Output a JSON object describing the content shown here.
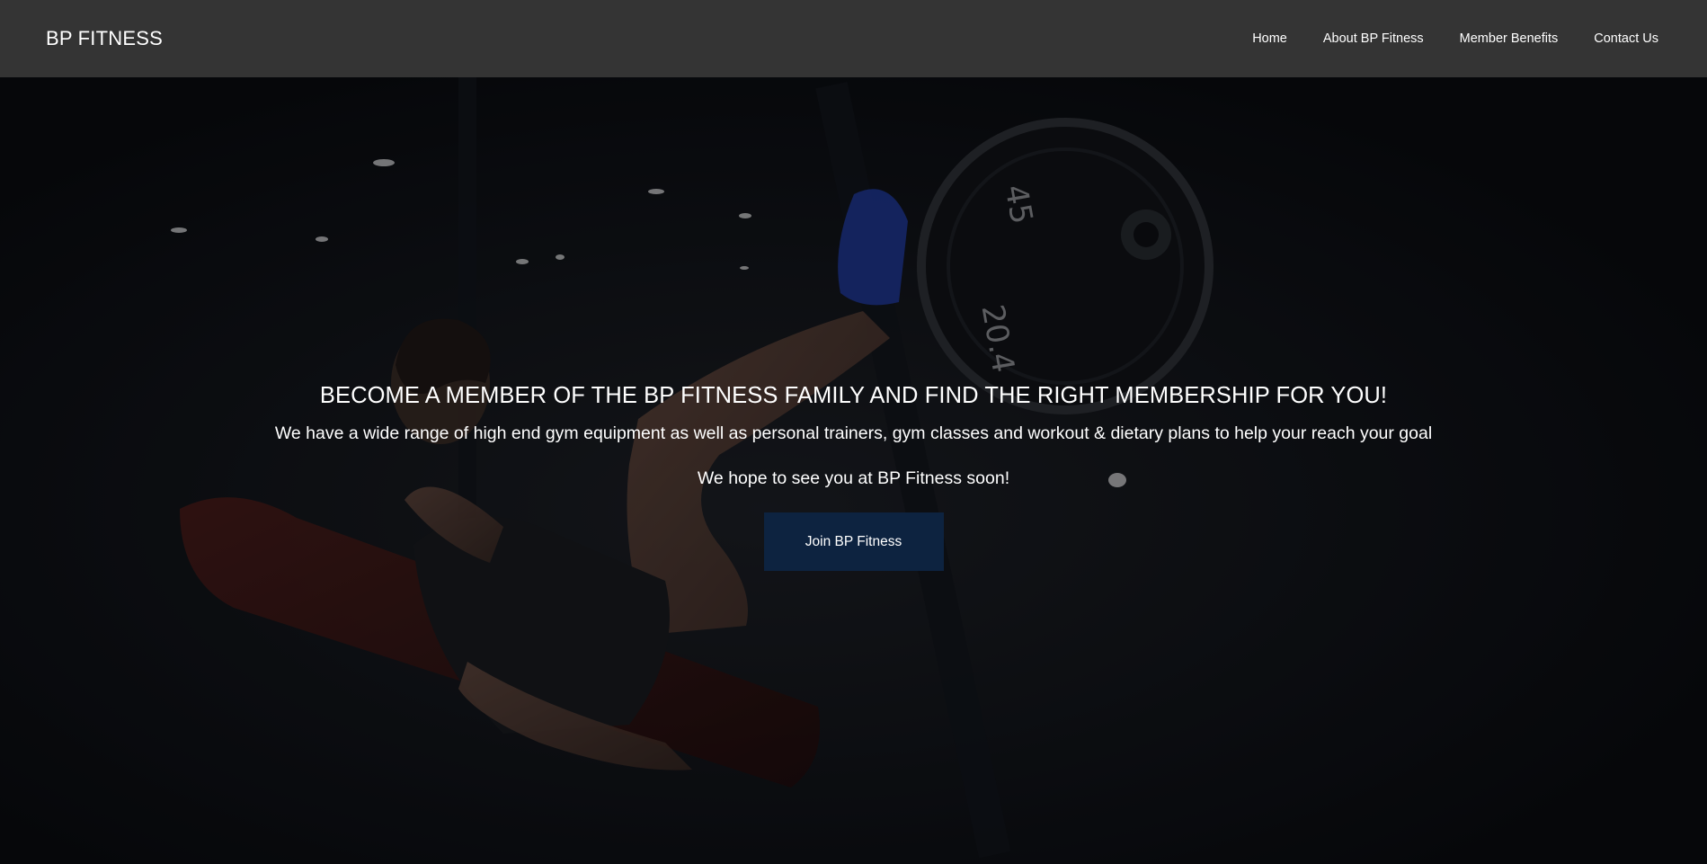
{
  "navbar": {
    "brand": "BP FITNESS",
    "links": [
      {
        "label": "Home"
      },
      {
        "label": "About BP Fitness"
      },
      {
        "label": "Member Benefits"
      },
      {
        "label": "Contact Us"
      }
    ]
  },
  "hero": {
    "heading": "BECOME A MEMBER OF THE BP FITNESS FAMILY AND FIND THE RIGHT MEMBERSHIP FOR YOU!",
    "text": "We have a wide range of high end gym equipment as well as personal trainers, gym classes and workout & dietary plans to help your reach your goal",
    "text2": "We hope to see you at BP Fitness soon!",
    "button_label": "Join BP Fitness",
    "image_plate_text_1": "45",
    "image_plate_text_2": "20.4"
  },
  "colors": {
    "navbar_bg": "#343434",
    "hero_bg": "#090c10",
    "button_bg": "#0d2340",
    "text": "#ffffff"
  }
}
